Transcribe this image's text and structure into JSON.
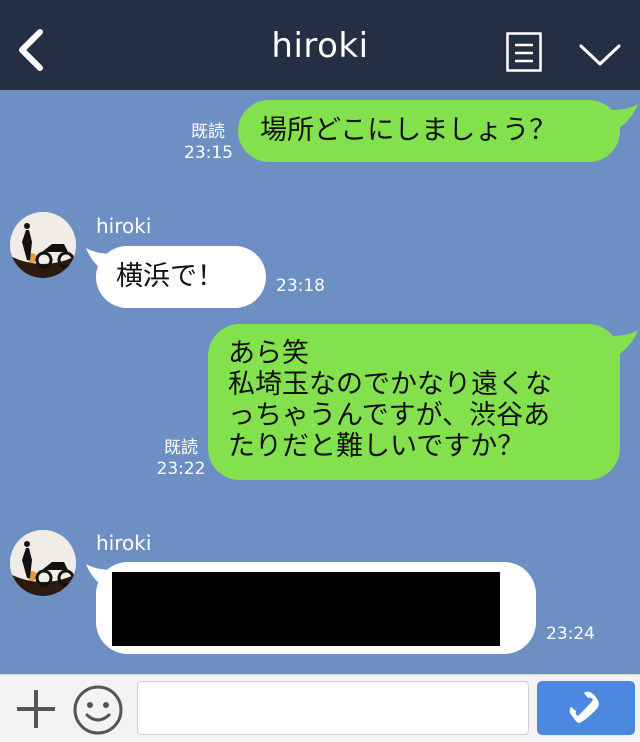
{
  "header": {
    "title": "hiroki",
    "back_icon": "chevron-left-icon",
    "notes_icon": "notes-icon",
    "menu_icon": "chevron-down-icon"
  },
  "messages": [
    {
      "from": "me",
      "text": "場所どこにしましょう？",
      "read": "既読",
      "time": "23:15"
    },
    {
      "from": "them",
      "sender": "hiroki",
      "text": "横浜で！",
      "time": "23:18"
    },
    {
      "from": "me",
      "lines": [
        "あら笑",
        "私埼玉なのでかなり遠くな",
        "っちゃうんですが、渋谷あ",
        "たりだと難しいですか？"
      ],
      "read": "既読",
      "time": "23:22"
    },
    {
      "from": "them",
      "sender": "hiroki",
      "redacted": true,
      "time": "23:24"
    }
  ],
  "footer": {
    "plus_icon": "plus-icon",
    "emoji_icon": "smiley-icon",
    "input_placeholder": "",
    "call_icon": "phone-icon"
  },
  "colors": {
    "header_bg": "#252f44",
    "chat_bg": "#6d8fc3",
    "my_bubble": "#84e14e",
    "their_bubble": "#ffffff",
    "call_button": "#4d88e0"
  }
}
